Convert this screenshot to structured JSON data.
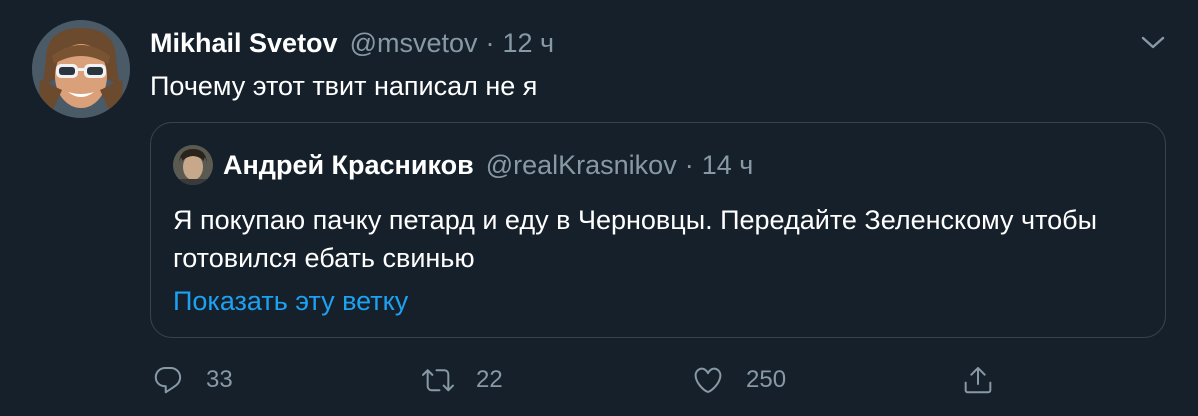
{
  "tweet": {
    "author_name": "Mikhail Svetov",
    "author_handle": "@msvetov",
    "separator": "·",
    "time": "12 ч",
    "text": "Почему этот твит написал не я"
  },
  "quoted_tweet": {
    "author_name": "Андрей Красников",
    "author_handle": "@realKrasnikov",
    "separator": "·",
    "time": "14 ч",
    "text": "Я покупаю пачку петард и еду в Черновцы. Передайте Зеленскому чтобы готовился ебать свинью",
    "show_thread_label": "Показать эту ветку"
  },
  "actions": {
    "reply_count": "33",
    "retweet_count": "22",
    "like_count": "250"
  },
  "icons": {
    "more": "chevron-down-icon",
    "reply": "reply-icon",
    "retweet": "retweet-icon",
    "like": "heart-icon",
    "share": "share-icon"
  },
  "colors": {
    "background": "#15202b",
    "secondary_text": "#8899a6",
    "link": "#1da1f2",
    "border": "#38444d"
  }
}
